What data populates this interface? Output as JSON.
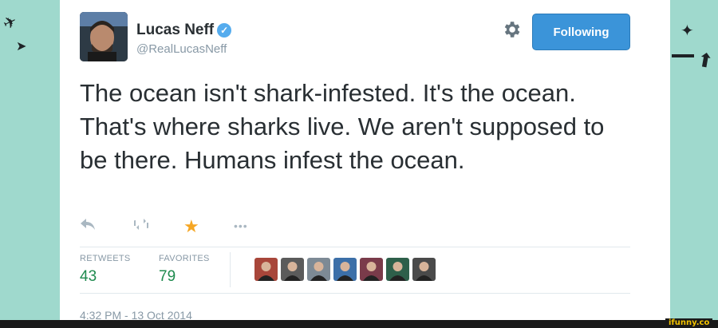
{
  "tweet": {
    "author": {
      "name": "Lucas Neff",
      "handle": "@RealLucasNeff",
      "verified": true,
      "avatar_icon": "profile-photo"
    },
    "follow_button": {
      "label": "Following"
    },
    "settings_icon": "gear-icon",
    "text": "The ocean isn't shark-infested. It's the ocean. That's where sharks live. We aren't supposed to be there. Humans infest the ocean.",
    "actions": [
      "reply-icon",
      "retweet-icon",
      "favorite-star-icon",
      "more-icon"
    ],
    "stats": {
      "retweets": {
        "label": "RETWEETS",
        "value": "43"
      },
      "favorites": {
        "label": "FAVORITES",
        "value": "79"
      }
    },
    "favoriters": [
      {
        "icon": "user-avatar",
        "color": "#a8463a"
      },
      {
        "icon": "user-avatar",
        "color": "#5b5b5b"
      },
      {
        "icon": "user-avatar",
        "color": "#7d8a95"
      },
      {
        "icon": "user-avatar",
        "color": "#3c6fa8"
      },
      {
        "icon": "user-avatar",
        "color": "#7a3b4a"
      },
      {
        "icon": "user-avatar",
        "color": "#2e5f4a"
      },
      {
        "icon": "user-avatar",
        "color": "#4a4a4a"
      }
    ],
    "timestamp": "4:32 PM - 13 Oct 2014"
  },
  "watermark": "ifunny.co",
  "colors": {
    "background": "#9fd9cd",
    "accent": "#3b94d9",
    "verified": "#55acee",
    "favorite": "#f5a623",
    "stat_value": "#1e8a4e"
  }
}
